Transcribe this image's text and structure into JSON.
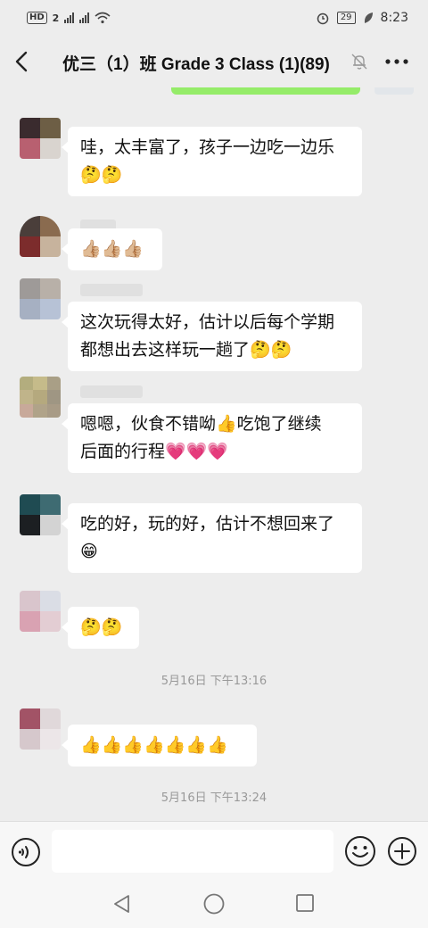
{
  "status_bar": {
    "left": "HD 2  2G  4G",
    "battery": "29",
    "time": "8:23"
  },
  "header": {
    "title": "优三（1）班 Grade 3  Class (1)(89)",
    "back_icon": "chevron-left-icon",
    "mute_icon": "bell-off-icon",
    "more_icon": "ellipsis-icon"
  },
  "messages": [
    {
      "text": "哇，太丰富了，孩子一边吃一边乐",
      "emoji": "🤔🤔"
    },
    {
      "text": "",
      "emoji": "👍🏼👍🏼👍🏼"
    },
    {
      "text": "这次玩得太好，估计以后每个学期",
      "text2": "都想出去这样玩一趟了🤔🤔"
    },
    {
      "text": "嗯嗯，伙食不错呦👍吃饱了继续",
      "text2": "后面的行程💗💗💗"
    },
    {
      "text": "吃的好，玩的好，估计不想回来了",
      "emoji": "😁"
    },
    {
      "text": "",
      "emoji": "🤔🤔"
    },
    {
      "text": "",
      "emoji": "👍👍👍👍👍👍👍"
    }
  ],
  "timestamps": [
    "5月16日 下午13:16",
    "5月16日 下午13:24"
  ],
  "input": {
    "placeholder": "",
    "voice_icon": "voice-icon",
    "emoji_icon": "smiley-icon",
    "plus_icon": "plus-circle-icon"
  },
  "nav": {
    "back_icon": "triangle-back-icon",
    "home_icon": "circle-home-icon",
    "recent_icon": "square-recent-icon"
  }
}
